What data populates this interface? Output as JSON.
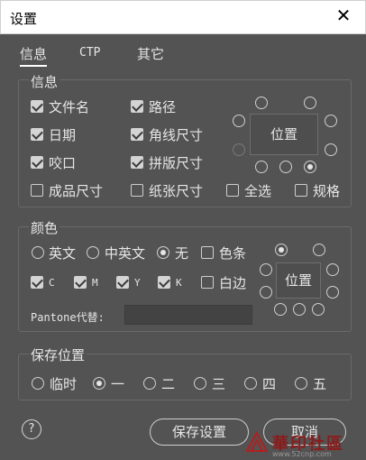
{
  "window": {
    "title": "设置",
    "close_label": "✕"
  },
  "tabs": [
    {
      "label": "信息",
      "active": true
    },
    {
      "label": "CTP",
      "active": false
    },
    {
      "label": "其它",
      "active": false
    }
  ],
  "info": {
    "label": "信息",
    "checkboxes": [
      {
        "label": "文件名",
        "checked": true
      },
      {
        "label": "路径",
        "checked": true
      },
      {
        "label": "日期",
        "checked": true
      },
      {
        "label": "角线尺寸",
        "checked": true
      },
      {
        "label": "咬口",
        "checked": true
      },
      {
        "label": "拼版尺寸",
        "checked": true
      },
      {
        "label": "成品尺寸",
        "checked": false
      },
      {
        "label": "纸张尺寸",
        "checked": false
      },
      {
        "label": "全选",
        "checked": false
      },
      {
        "label": "规格",
        "checked": false
      }
    ],
    "position_label": "位置"
  },
  "color": {
    "label": "颜色",
    "language_options": [
      {
        "label": "英文",
        "checked": false
      },
      {
        "label": "中英文",
        "checked": false
      },
      {
        "label": "无",
        "checked": true
      }
    ],
    "color_bar": {
      "label": "色条",
      "checked": false
    },
    "channels": [
      {
        "label": "C",
        "checked": true
      },
      {
        "label": "M",
        "checked": true
      },
      {
        "label": "Y",
        "checked": true
      },
      {
        "label": "K",
        "checked": true
      }
    ],
    "border": {
      "label": "白边",
      "checked": false
    },
    "pantone_label": "Pantone代替:",
    "pantone_value": "",
    "position_label": "位置"
  },
  "save_location": {
    "label": "保存位置",
    "options": [
      {
        "label": "临时",
        "checked": false
      },
      {
        "label": "一",
        "checked": true
      },
      {
        "label": "二",
        "checked": false
      },
      {
        "label": "三",
        "checked": false
      },
      {
        "label": "四",
        "checked": false
      },
      {
        "label": "五",
        "checked": false
      }
    ]
  },
  "footer": {
    "help_label": "?",
    "save_button": "保存设置",
    "cancel_button": "取消"
  },
  "watermark": {
    "text": "華印社區",
    "url": "www.52cnp.com"
  }
}
